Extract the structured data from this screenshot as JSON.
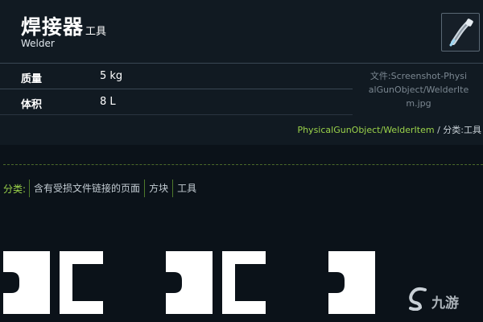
{
  "item": {
    "title": "焊接器",
    "type": "工具",
    "subtitle": "Welder",
    "thumbnail_icon": "welder-tool-icon"
  },
  "properties": [
    {
      "label": "质量",
      "value": "5 kg"
    },
    {
      "label": "体积",
      "value": "8 L"
    }
  ],
  "file": {
    "line1": "文件:Screenshot-Physi",
    "line2": "alGunObject/WelderIte",
    "line3": "m.jpg"
  },
  "category_line": {
    "link": "PhysicalGunObject/WelderItem",
    "separator": " / ",
    "suffix": "分类:工具"
  },
  "categories": {
    "label": "分类:",
    "items": [
      "含有受损文件链接的页面",
      "方块",
      "工具"
    ]
  },
  "watermark": {
    "text": "九游",
    "icon": "jiuyou-logo-icon"
  },
  "colors": {
    "background": "#0b1219",
    "panel": "#111a22",
    "link": "#9bd34a"
  }
}
